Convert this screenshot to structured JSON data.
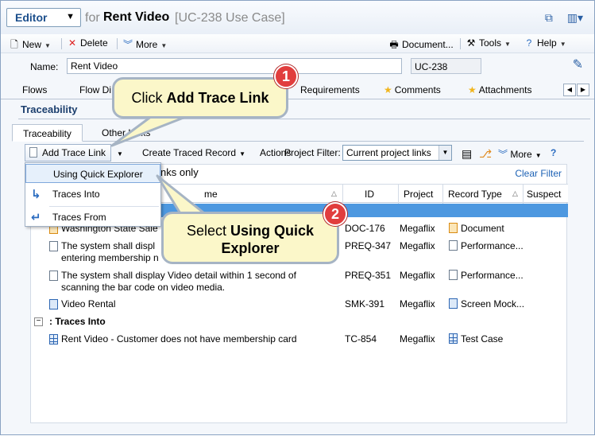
{
  "titlebar": {
    "editor_label": "Editor",
    "for_text": "for",
    "record_name": "Rent Video",
    "record_id": "[UC-238 Use Case]"
  },
  "toolbar": {
    "new": "New",
    "delete": "Delete",
    "more": "More",
    "document": "Document...",
    "tools": "Tools",
    "help": "Help"
  },
  "name_field": {
    "label": "Name:",
    "value": "Rent Video",
    "id_value": "UC-238"
  },
  "tabs": [
    {
      "label": "Flows"
    },
    {
      "label": "Flow Di"
    },
    {
      "label": "Requirements"
    },
    {
      "label": "Comments"
    },
    {
      "label": "Attachments"
    }
  ],
  "section": {
    "title": "Traceability"
  },
  "subtabs": [
    {
      "label": "Traceability"
    },
    {
      "label": "Other Links"
    }
  ],
  "panel_toolbar": {
    "add_trace_link": "Add Trace Link",
    "create_traced_record": "Create Traced Record",
    "actions": "Actions",
    "project_filter_label": "Project Filter:",
    "project_filter_value": "Current project links",
    "more": "More"
  },
  "grid": {
    "info_text": "nks only",
    "clear_filter": "Clear Filter",
    "headers": {
      "name": "me",
      "id": "ID",
      "project": "Project",
      "record_type": "Record Type",
      "suspect": "Suspect"
    },
    "rows_traces_to": [
      {
        "name": "Washington State Sale",
        "id": "DOC-176",
        "project": "Megaflix",
        "type": "Document",
        "icon": "orange-doc-icon"
      },
      {
        "name": "The system shall displ\nentering membership n",
        "id": "PREQ-347",
        "project": "Megaflix",
        "type": "Performance...",
        "icon": "doc-icon"
      },
      {
        "name": "The system shall display Video detail within 1 second of\nscanning the bar code on video media.",
        "id": "PREQ-351",
        "project": "Megaflix",
        "type": "Performance...",
        "icon": "doc-icon"
      },
      {
        "name": "Video Rental",
        "id": "SMK-391",
        "project": "Megaflix",
        "type": "Screen Mock...",
        "icon": "blue-doc-icon"
      }
    ],
    "group_traces_into": {
      "expander": "−",
      "label": ": Traces Into"
    },
    "rows_traces_into": [
      {
        "name": "Rent Video - Customer does not have membership card",
        "id": "TC-854",
        "project": "Megaflix",
        "type": "Test Case",
        "icon": "grid-icon"
      }
    ]
  },
  "dropdown_menu": {
    "items": [
      {
        "label": "Using Quick Explorer"
      },
      {
        "label": "Traces Into"
      },
      {
        "label": "Traces From"
      }
    ]
  },
  "callouts": {
    "step1": {
      "number": "1",
      "prefix": "Click ",
      "bold": "Add Trace Link"
    },
    "step2": {
      "number": "2",
      "prefix": "Select ",
      "bold_line1": "Using Quick",
      "bold_line2": "Explorer"
    }
  }
}
